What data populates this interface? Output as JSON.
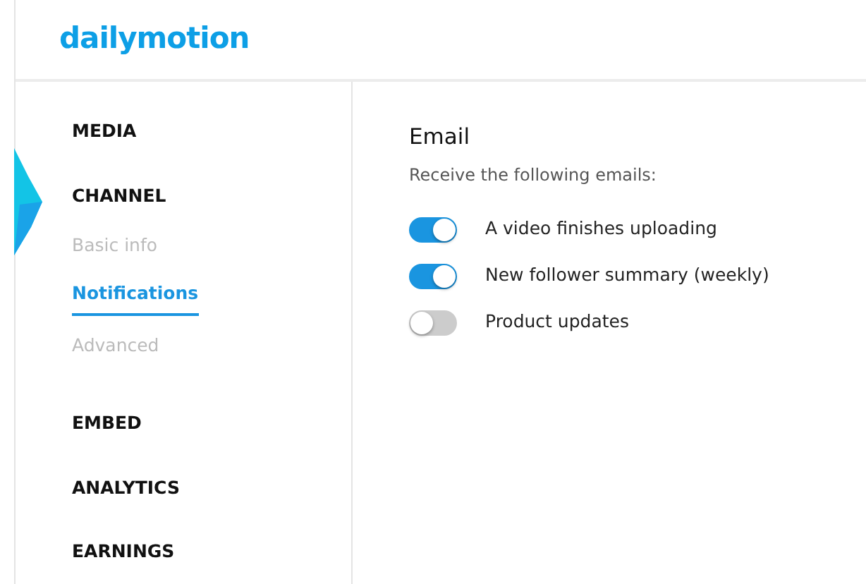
{
  "header": {
    "logo": "dailymotion"
  },
  "sidebar": {
    "items": [
      {
        "label": "MEDIA",
        "selected": false
      },
      {
        "label": "CHANNEL",
        "selected": false,
        "children": [
          {
            "label": "Basic info",
            "selected": false
          },
          {
            "label": "Notifications",
            "selected": true
          },
          {
            "label": "Advanced",
            "selected": false
          }
        ]
      },
      {
        "label": "EMBED",
        "selected": false
      },
      {
        "label": "ANALYTICS",
        "selected": false
      },
      {
        "label": "EARNINGS",
        "selected": false
      }
    ]
  },
  "content": {
    "title": "Email",
    "subtitle": "Receive the following emails:",
    "toggles": [
      {
        "label": "A video finishes uploading",
        "on": true
      },
      {
        "label": "New follower summary (weekly)",
        "on": true
      },
      {
        "label": "Product updates",
        "on": false
      }
    ]
  }
}
